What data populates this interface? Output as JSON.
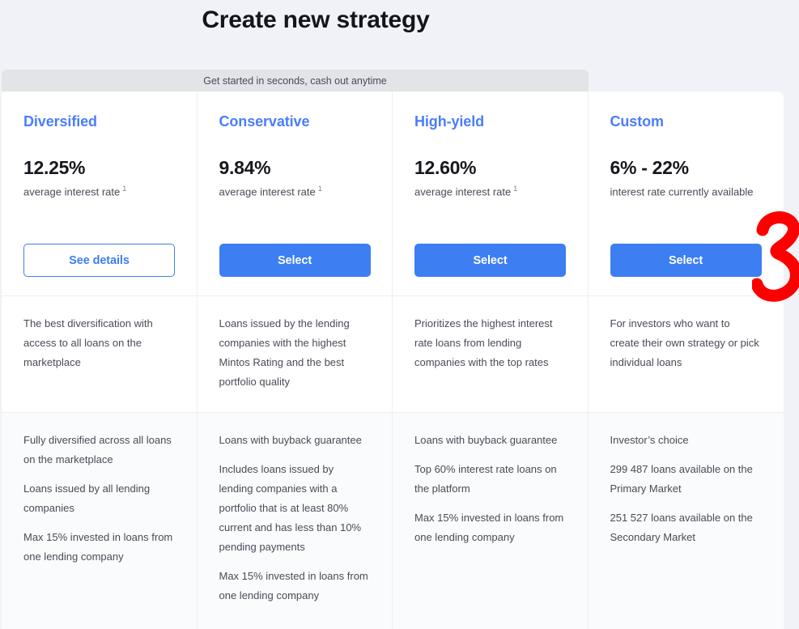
{
  "page": {
    "title": "Create new strategy",
    "background_color": "#f0f2f7"
  },
  "promo_banner": {
    "text": "Get started in seconds, cash out anytime",
    "background_color": "#e3e4e8"
  },
  "theme": {
    "accent_blue": "#3d7ef2",
    "heading_blue": "#4a7dfc",
    "body_text": "#4a4b57",
    "card_background": "#ffffff",
    "features_background": "#fafbfc",
    "annotation_red": "#fc0000"
  },
  "strategies": [
    {
      "name": "Diversified",
      "rate": "12.25%",
      "rate_label": "average interest rate",
      "footnote": "1",
      "action_label": "See details",
      "action_style": "outline",
      "description": "The best diversification with access to all loans on the marketplace",
      "features": [
        "Fully diversified across all loans on the marketplace",
        "Loans issued by all lending companies",
        "Max 15% invested in loans from one lending company"
      ]
    },
    {
      "name": "Conservative",
      "rate": "9.84%",
      "rate_label": "average interest rate",
      "footnote": "1",
      "action_label": "Select",
      "action_style": "primary",
      "description": "Loans issued by the lending companies with the highest Mintos Rating and the best portfolio quality",
      "features": [
        "Loans with buyback guarantee",
        "Includes loans issued by lending companies with a portfolio that is at least 80% current and has less than 10% pending payments",
        "Max 15% invested in loans from one lending company"
      ]
    },
    {
      "name": "High-yield",
      "rate": "12.60%",
      "rate_label": "average interest rate",
      "footnote": "1",
      "action_label": "Select",
      "action_style": "primary",
      "description": "Prioritizes the highest interest rate loans from lending companies with the top rates",
      "features": [
        "Loans with buyback guarantee",
        "Top 60% interest rate loans on the platform",
        "Max 15% invested in loans from one lending company"
      ]
    },
    {
      "name": "Custom",
      "rate": "6% - 22%",
      "rate_label": "interest rate currently available",
      "footnote": "",
      "action_label": "Select",
      "action_style": "primary",
      "description": "For investors who want to create their own strategy or pick individual loans",
      "features": [
        "Investor’s choice",
        "299 487 loans available on the Primary Market",
        "251 527 loans available on the Secondary Market"
      ]
    }
  ],
  "annotation": {
    "label": "3",
    "color": "#fc0000"
  }
}
